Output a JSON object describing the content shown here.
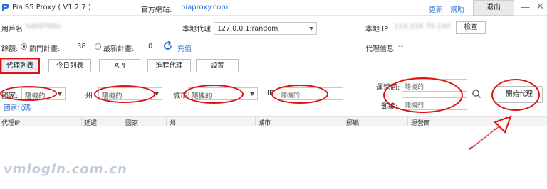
{
  "app": {
    "title": "Pia S5 Proxy  ( V1.2.7 )"
  },
  "site": {
    "label": "官方網站:",
    "url": "piaproxy.com"
  },
  "top_links": {
    "update": "更新",
    "help": "幫助",
    "exit": "退出"
  },
  "user": {
    "label": "用戶名:",
    "value": "lu6ld766s"
  },
  "local_proxy": {
    "label": "本地代理",
    "value": "127.0.0.1:random"
  },
  "local_ip": {
    "label": "本地 IP",
    "value": "114.234.76.140",
    "check_button": "檢查"
  },
  "balance": {
    "label": "餘額:",
    "popular_label": "熱門計畫:",
    "popular_value": "38",
    "latest_label": "最新計畫:",
    "latest_value": "0",
    "recharge": "充值"
  },
  "proxy_info": {
    "label": "代理信息",
    "value": "--"
  },
  "tabs": [
    "代理列表",
    "今日列表",
    "API",
    "進程代理",
    "設置"
  ],
  "filters": {
    "country_label": "國家:",
    "country_value": "隨機的",
    "country_code_link": "國家代碼",
    "state_label": "州",
    "state_value": "隨機的",
    "city_label": "城市",
    "city_value": "隨機的",
    "ip_label": "IP",
    "ip_value": "隨機的",
    "isp_label": "運營商:",
    "isp_value": "隨機的",
    "zip_label": "郵編:",
    "zip_value": "隨機的",
    "start_button": "開始代理"
  },
  "table": {
    "columns": [
      "代理IP",
      "延遲",
      "國家",
      "州",
      "城市",
      "郵編",
      "運營商"
    ]
  },
  "watermark": "vmlogin.com.cn",
  "colors": {
    "accent": "#2d6fd4",
    "annotation": "#e01010",
    "orange": "#f07b21"
  },
  "icons": [
    "pia-logo-icon",
    "minimize-icon",
    "close-icon",
    "refresh-icon",
    "search-icon",
    "chevron-down-icon",
    "annotation-arrow-icon"
  ]
}
